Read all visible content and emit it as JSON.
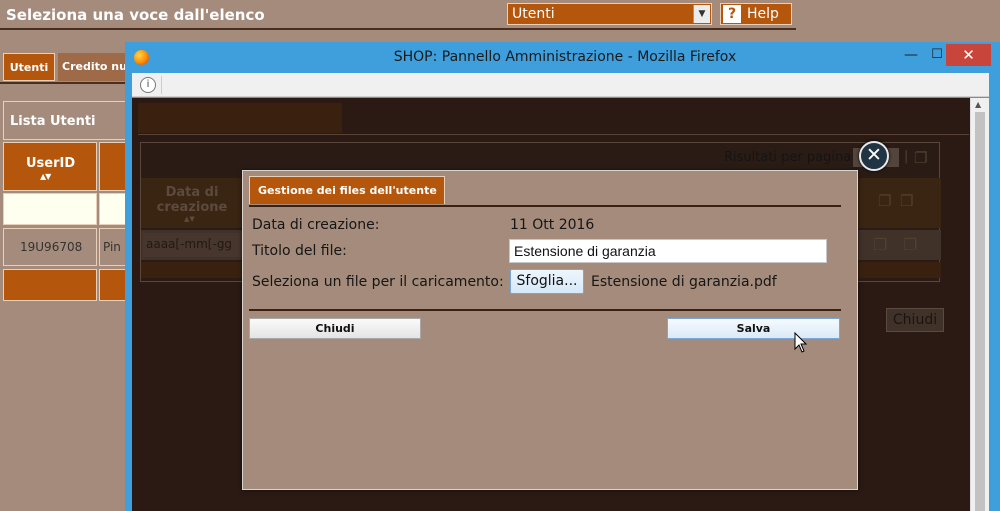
{
  "background_page": {
    "header_title": "Seleziona una voce dall'elenco",
    "voce_select": {
      "value": "Utenti",
      "icon": "chevron-down-icon"
    },
    "help": {
      "icon": "question-icon",
      "label": "Help"
    },
    "tabs": [
      {
        "label": "Utenti"
      },
      {
        "label": "Credito nu"
      }
    ],
    "lista_title": "Lista Utenti",
    "table": {
      "header_userid": "UserID",
      "sort_glyph": "▲▼",
      "row_userid": "19U96708",
      "row_name": "Pin"
    }
  },
  "firefox_window": {
    "title": "SHOP: Pannello Amministrazione - Mozilla Firefox",
    "minimize_glyph": "—",
    "maximize_glyph": "☐",
    "close_glyph": "✕",
    "info_glyph": "i",
    "scroll_up_glyph": "▲"
  },
  "dimmed_page": {
    "risultati_label": "Risultati per pagina:",
    "separator": "|",
    "data_header": "Data di creazione",
    "date_input_value": "aaaa[-mm[-gg",
    "chiudi_label": "Chiudi",
    "icons": [
      "copy-icon",
      "copy-icon",
      "edit-icon"
    ]
  },
  "modal": {
    "tab_title": "Gestione dei files dell'utente",
    "close_glyph": "✕",
    "fields": {
      "data_creazione_label": "Data di creazione:",
      "data_creazione_value": "11 Ott 2016",
      "titolo_label": "Titolo del file:",
      "titolo_value": "Estensione di garanzia",
      "upload_label": "Seleziona un file per il caricamento:",
      "sfoglia_label": "Sfoglia...",
      "selected_file": "Estensione di garanzia.pdf"
    },
    "buttons": {
      "chiudi": "Chiudi",
      "salva": "Salva"
    }
  },
  "colors": {
    "background": "#a58b7b",
    "accent": "#b4560c",
    "dark_overlay": "#2a1a13",
    "firefox_frame": "#3f9fdd",
    "close_red": "#c7453a"
  }
}
